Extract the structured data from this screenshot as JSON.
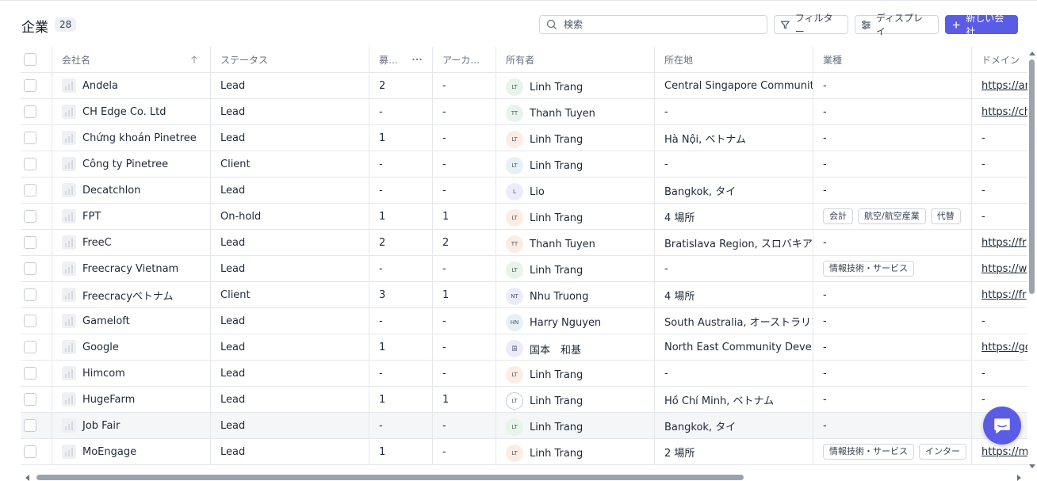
{
  "header": {
    "title": "企業",
    "count": "28",
    "search_placeholder": "検索",
    "filter_label": "フィルター",
    "display_label": "ディスプレイ",
    "new_label": "新しい会社"
  },
  "accent_color": "#5b5ce6",
  "columns": {
    "name": "会社名",
    "status": "ステータス",
    "recruit": "募…",
    "archive": "アーカ…",
    "owner": "所有者",
    "location": "所在地",
    "industry": "業種",
    "domain": "ドメイン"
  },
  "rows": [
    {
      "name": "Andela",
      "status": "Lead",
      "recruit": "2",
      "archive": "-",
      "owner_initials": "LT",
      "owner": "Linh Trang",
      "location": "Central Singapore Community",
      "industry": "-",
      "tags": [],
      "domain": "https://an",
      "avatar_color": "#e6f4ea"
    },
    {
      "name": "CH Edge Co. Ltd",
      "status": "Lead",
      "recruit": "-",
      "archive": "-",
      "owner_initials": "TT",
      "owner": "Thanh Tuyen",
      "location": "-",
      "industry": "-",
      "tags": [],
      "domain": "https://ch",
      "avatar_color": "#e8f3ec"
    },
    {
      "name": "Chứng khoán Pinetree",
      "status": "Lead",
      "recruit": "1",
      "archive": "-",
      "owner_initials": "LT",
      "owner": "Linh Trang",
      "location": "Hà Nội, ベトナム",
      "industry": "-",
      "tags": [],
      "domain": "-",
      "avatar_color": "#fdece3"
    },
    {
      "name": "Công ty Pinetree",
      "status": "Client",
      "recruit": "-",
      "archive": "-",
      "owner_initials": "LT",
      "owner": "Linh Trang",
      "location": "-",
      "industry": "-",
      "tags": [],
      "domain": "-",
      "avatar_color": "#e6f0f7"
    },
    {
      "name": "Decatchlon",
      "status": "Lead",
      "recruit": "-",
      "archive": "-",
      "owner_initials": "L",
      "owner": "Lio",
      "location": "Bangkok, タイ",
      "industry": "-",
      "tags": [],
      "domain": "-",
      "avatar_color": "#ecebfb"
    },
    {
      "name": "FPT",
      "status": "On-hold",
      "recruit": "1",
      "archive": "1",
      "owner_initials": "LT",
      "owner": "Linh Trang",
      "location": "4 場所",
      "industry": "",
      "tags": [
        "会計",
        "航空/航空産業",
        "代替"
      ],
      "domain": "-",
      "avatar_color": "#fdece3"
    },
    {
      "name": "FreeC",
      "status": "Lead",
      "recruit": "2",
      "archive": "2",
      "owner_initials": "TT",
      "owner": "Thanh Tuyen",
      "location": "Bratislava Region, スロバキア",
      "industry": "-",
      "tags": [],
      "domain": "https://fr",
      "avatar_color": "#fdece3"
    },
    {
      "name": "Freecracy Vietnam",
      "status": "Lead",
      "recruit": "-",
      "archive": "-",
      "owner_initials": "LT",
      "owner": "Linh Trang",
      "location": "-",
      "industry": "",
      "tags": [
        "情報技術・サービス"
      ],
      "domain": "https://w",
      "avatar_color": "#e6f4ea"
    },
    {
      "name": "Freecracyベトナム",
      "status": "Client",
      "recruit": "3",
      "archive": "1",
      "owner_initials": "NT",
      "owner": "Nhu Truong",
      "location": "4 場所",
      "industry": "-",
      "tags": [],
      "domain": "https://fr",
      "avatar_color": "#ecebfb"
    },
    {
      "name": "Gameloft",
      "status": "Lead",
      "recruit": "-",
      "archive": "-",
      "owner_initials": "HN",
      "owner": "Harry Nguyen",
      "location": "South Australia, オーストラリア",
      "industry": "-",
      "tags": [],
      "domain": "-",
      "avatar_color": "#e6f0f7"
    },
    {
      "name": "Google",
      "status": "Lead",
      "recruit": "1",
      "archive": "-",
      "owner_initials": "国",
      "owner": "国本　和基",
      "location": "North East Community Develop",
      "industry": "-",
      "tags": [],
      "domain": "https://go",
      "avatar_color": "#ecebfb"
    },
    {
      "name": "Himcom",
      "status": "Lead",
      "recruit": "-",
      "archive": "-",
      "owner_initials": "LT",
      "owner": "Linh Trang",
      "location": "-",
      "industry": "-",
      "tags": [],
      "domain": "-",
      "avatar_color": "#fdece3"
    },
    {
      "name": "HugeFarm",
      "status": "Lead",
      "recruit": "1",
      "archive": "1",
      "owner_initials": "LT",
      "owner": "Linh Trang",
      "location": "Hồ Chí Minh, ベトナム",
      "industry": "-",
      "tags": [],
      "domain": "-",
      "avatar_color": "#ffffff"
    },
    {
      "name": "Job Fair",
      "status": "Lead",
      "recruit": "-",
      "archive": "-",
      "owner_initials": "LT",
      "owner": "Linh Trang",
      "location": "Bangkok, タイ",
      "industry": "-",
      "tags": [],
      "domain": "",
      "avatar_color": "#e6f4ea"
    },
    {
      "name": "MoEngage",
      "status": "Lead",
      "recruit": "1",
      "archive": "-",
      "owner_initials": "LT",
      "owner": "Linh Trang",
      "location": "2 場所",
      "industry": "",
      "tags": [
        "情報技術・サービス",
        "インター"
      ],
      "domain": "https://m",
      "avatar_color": "#fdece3"
    }
  ]
}
